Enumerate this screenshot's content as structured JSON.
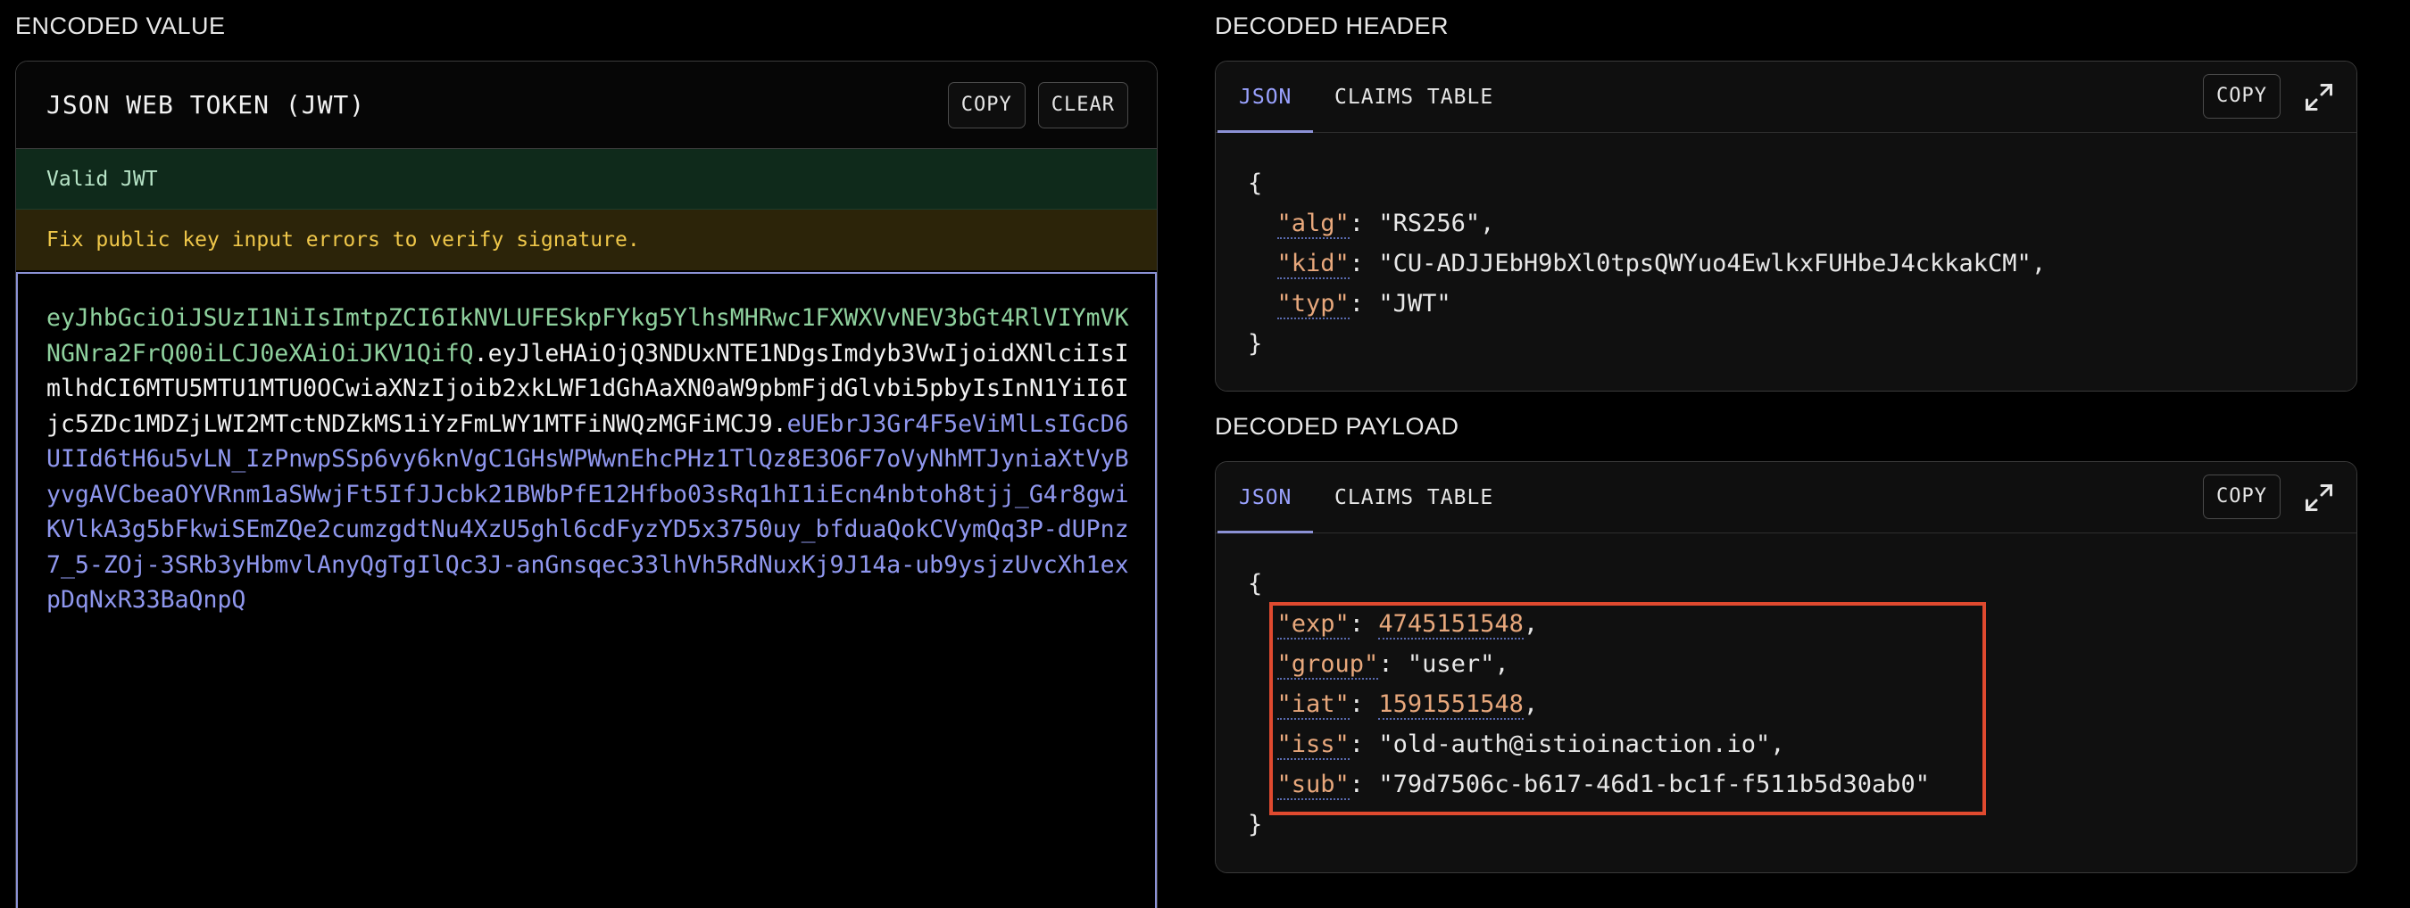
{
  "encoded": {
    "section_title": "ENCODED VALUE",
    "card_title": "JSON WEB TOKEN (JWT)",
    "copy_label": "COPY",
    "clear_label": "CLEAR",
    "valid_text": "Valid JWT",
    "warning_text": "Fix public key input errors to verify signature.",
    "token_header": "eyJhbGciOiJSUzI1NiIsImtpZCI6IkNVLUFESkpFYkg5YlhsMHRwc1FXWXVvNEV3bGt4RlVIYmVKNGNra2FrQ00iLCJ0eXAiOiJKV1QifQ",
    "token_payload": "eyJleHAiOjQ3NDUxNTE1NDgsImdyb3VwIjoidXNlciIsImlhdCI6MTU5MTU1MTU0OCwiaXNzIjoib2xkLWF1dGhAaXN0aW9pbmFjdGlvbi5pbyIsInN1YiI6Ijc5ZDc1MDZjLWI2MTctNDZkMS1iYzFmLWY1MTFiNWQzMGFiMCJ9",
    "token_signature": "eUEbrJ3Gr4F5eViMlLsIGcD6UIId6tH6u5vLN_IzPnwpSSp6vy6knVgC1GHsWPWwnEhcPHz1TlQz8E3O6F7oVyNhMTJyniaXtVyByvgAVCbeaOYVRnm1aSWwjFt5IfJJcbk21BWbPfE12Hfbo03sRq1hI1iEcn4nbtoh8tjj_G4r8gwiKVlkA3g5bFkwiSEmZQe2cumzgdtNu4XzU5ghl6cdFyzYD5x3750uy_bfduaQokCVymQq3P-dUPnz7_5-ZOj-3SRb3yHbmvlAnyQgTgIlQc3J-anGnsqec33lhVh5RdNuxKj9J14a-ub9ysjzUvcXh1expDqNxR33BaQnpQ",
    "dot": "."
  },
  "header": {
    "section_title": "DECODED HEADER",
    "tab_json": "JSON",
    "tab_claims": "CLAIMS TABLE",
    "copy_label": "COPY",
    "expand_icon": "expand-icon",
    "open_brace": "{",
    "close_brace": "}",
    "claims": [
      {
        "key": "\"alg\"",
        "value": "\"RS256\"",
        "sep": ","
      },
      {
        "key": "\"kid\"",
        "value": "\"CU-ADJJEbH9bXl0tpsQWYuo4EwlkxFUHbeJ4ckkakCM\"",
        "sep": ","
      },
      {
        "key": "\"typ\"",
        "value": "\"JWT\"",
        "sep": ""
      }
    ]
  },
  "payload": {
    "section_title": "DECODED PAYLOAD",
    "tab_json": "JSON",
    "tab_claims": "CLAIMS TABLE",
    "copy_label": "COPY",
    "expand_icon": "expand-icon",
    "open_brace": "{",
    "close_brace": "}",
    "claims": [
      {
        "key": "\"exp\"",
        "value": "4745151548",
        "sep": ","
      },
      {
        "key": "\"group\"",
        "value": "\"user\"",
        "sep": ","
      },
      {
        "key": "\"iat\"",
        "value": "1591551548",
        "sep": ","
      },
      {
        "key": "\"iss\"",
        "value": "\"old-auth@istioinaction.io\"",
        "sep": ","
      },
      {
        "key": "\"sub\"",
        "value": "\"79d7506c-b617-46d1-bc1f-f511b5d30ab0\"",
        "sep": ""
      }
    ]
  },
  "colors": {
    "accent": "#8c92d6",
    "valid_bg": "#0f2a1b",
    "warn_bg": "#2c2409",
    "highlight": "#e04a2f"
  }
}
